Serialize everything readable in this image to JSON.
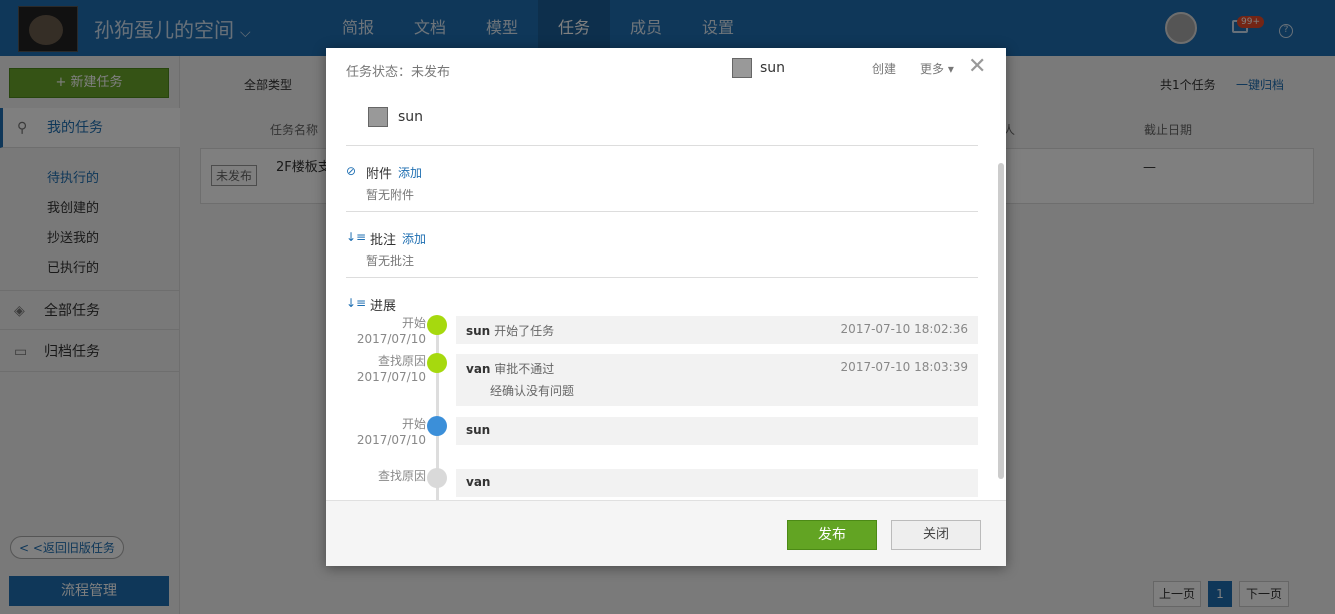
{
  "app": {
    "space_title": "孙狗蛋儿的空间",
    "badge": "99+"
  },
  "nav": [
    "简报",
    "文档",
    "模型",
    "任务",
    "成员",
    "设置"
  ],
  "sidebar": {
    "new_task": "+ 新建任务",
    "my_tasks": "我的任务",
    "sub_items": [
      "待执行的",
      "我创建的",
      "抄送我的",
      "已执行的"
    ],
    "all_tasks": "全部任务",
    "archived_tasks": "归档任务",
    "back_old": "< <返回旧版任务",
    "flow_manage": "流程管理"
  },
  "main": {
    "filter_type": "全部类型",
    "total": "共1个任务",
    "one_archive": "一键归档",
    "headers": {
      "name": "任务名称",
      "person": "人",
      "deadline": "截止日期"
    },
    "row": {
      "badge": "未发布",
      "name": "2F楼板支",
      "deadline": "—"
    },
    "pager": {
      "prev": "上一页",
      "page": "1",
      "next": "下一页"
    }
  },
  "modal": {
    "status": "任务状态：未发布",
    "owner": "sun",
    "create": "创建",
    "more": "更多 ▾",
    "close": "✕",
    "user": "sun",
    "attach": {
      "title": "附件",
      "add": "添加",
      "empty": "暂无附件"
    },
    "comment": {
      "title": "批注",
      "add": "添加",
      "empty": "暂无批注"
    },
    "progress": {
      "title": "进展",
      "entries": [
        {
          "label": "开始",
          "date": "2017/07/10",
          "who": "sun",
          "action": "开始了任务",
          "time": "2017-07-10 18:02:36",
          "note": ""
        },
        {
          "label": "查找原因",
          "date": "2017/07/10",
          "who": "van",
          "action": "审批不通过",
          "time": "2017-07-10 18:03:39",
          "note": "经确认没有问题"
        },
        {
          "label": "开始",
          "date": "2017/07/10",
          "who": "sun",
          "action": "",
          "time": "",
          "note": ""
        },
        {
          "label": "查找原因",
          "date": "",
          "who": "van",
          "action": "",
          "time": "",
          "note": ""
        }
      ]
    },
    "publish": "发布",
    "close_btn": "关闭"
  },
  "colors": {
    "accent": "#1f6fb2",
    "green": "#62a423",
    "dot_green": "#a6d90e",
    "dot_blue": "#3b8fd9",
    "dot_grey": "#d9d9d9"
  }
}
